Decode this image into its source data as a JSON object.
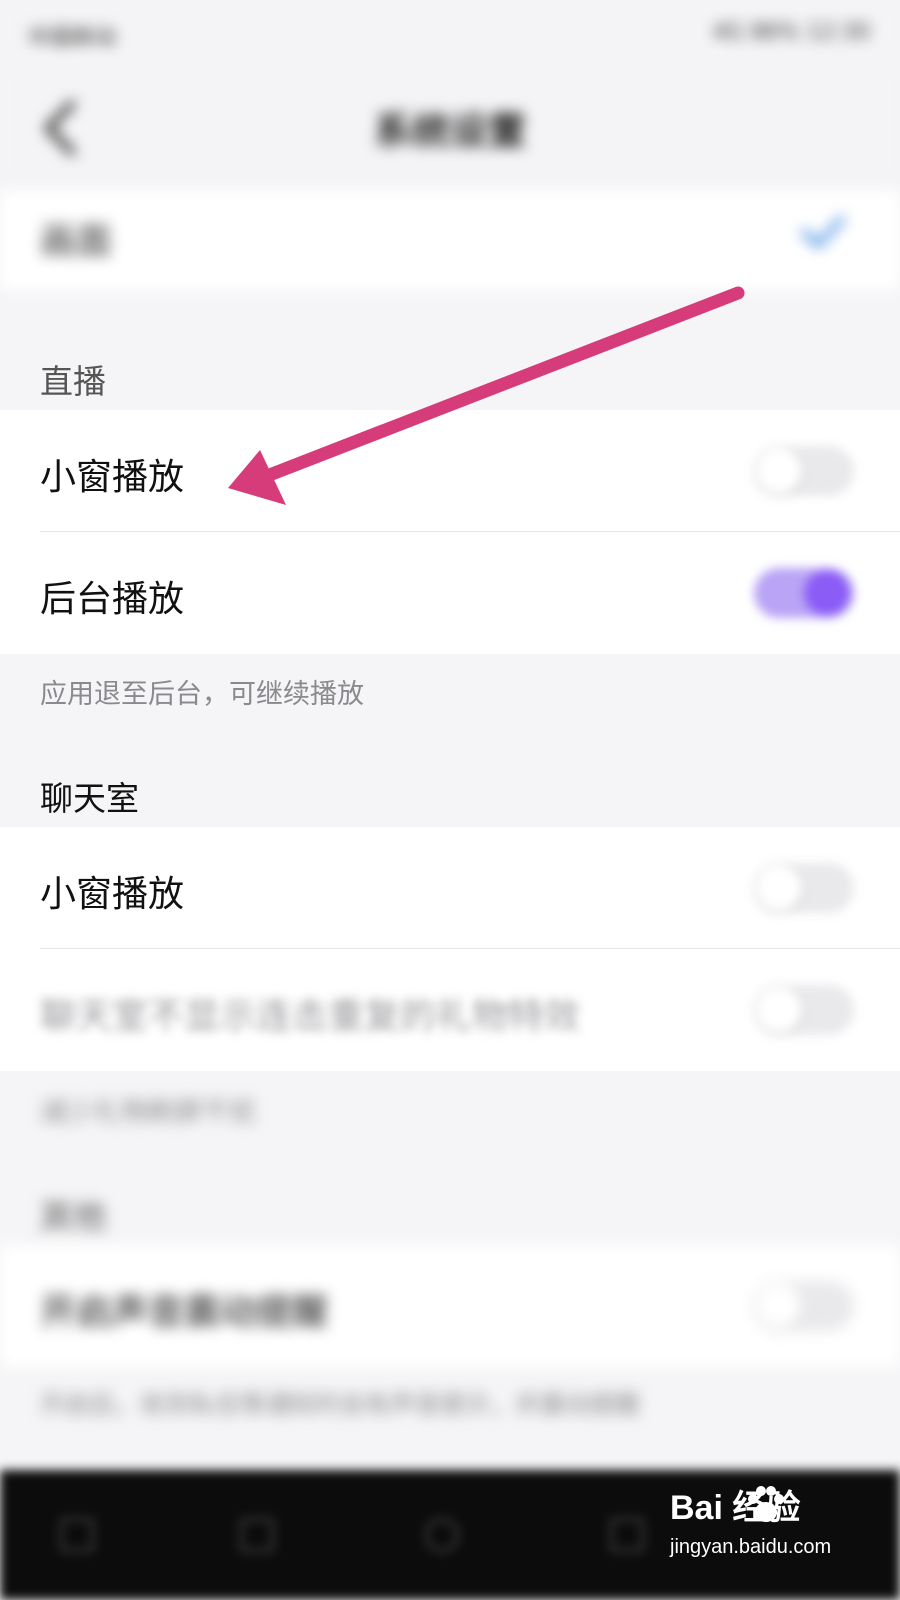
{
  "status_bar": {
    "left": "中国移动",
    "right": "4G 86% 12:30"
  },
  "header": {
    "title": "系统设置"
  },
  "top_row": {
    "label": "画面"
  },
  "sections": {
    "live": {
      "title": "直播",
      "row1_label": "小窗播放",
      "row1_toggle": "off",
      "row2_label": "后台播放",
      "row2_toggle": "on",
      "hint": "应用退至后台，可继续播放"
    },
    "chatroom": {
      "title": "聊天室",
      "row1_label": "小窗播放",
      "row1_toggle": "off",
      "row2_label": "聊天室不显示连击重复的礼物特效",
      "row2_toggle": "off",
      "hint": "减少礼物刷屏干扰"
    },
    "other": {
      "title": "其他",
      "row1_label": "开启声音震动提醒",
      "row1_toggle": "off",
      "hint": "开启后，收到私信等通知时会有声音提示，并震动提醒"
    }
  },
  "watermark": {
    "brand": "Bai  经验",
    "url": "jingyan.baidu.com"
  },
  "colors": {
    "accent": "#8b5cf6",
    "annotation_arrow": "#d63b7a",
    "check_blue": "#4a90e2"
  }
}
